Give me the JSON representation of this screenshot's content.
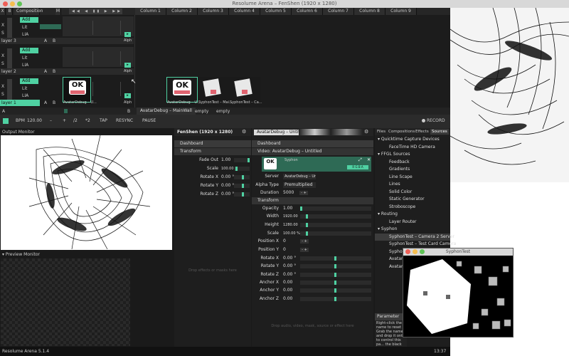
{
  "window": {
    "title": "Resolume Arena – FenShen (1920 x 1280)"
  },
  "grid": {
    "x_label": "X",
    "b_label": "B",
    "composition_label": "Composition",
    "m_label": "M",
    "columns": [
      "Column 1",
      "Column 2",
      "Column 3",
      "Column 4",
      "Column 5",
      "Column 6",
      "Column 7",
      "Column 8",
      "Column 9"
    ],
    "layers": [
      {
        "name": "layer 3",
        "add": "Add",
        "blend1": "Lit",
        "blend2": "LIA",
        "a": "A",
        "b": "B",
        "alpha": "Alph",
        "x": "X",
        "s": "S"
      },
      {
        "name": "layer 2",
        "add": "Add",
        "blend1": "Lit",
        "blend2": "LIA",
        "a": "A",
        "b": "B",
        "alpha": "Alph",
        "x": "X",
        "s": "S"
      },
      {
        "name": "layer 1",
        "add": "Add",
        "blend1": "Lit",
        "blend2": "LIA",
        "a": "A",
        "b": "B",
        "alpha": "Alph",
        "x": "X",
        "s": "S"
      }
    ],
    "clips": [
      "AvatarDebug – U...",
      "SyphonTest – Mai...",
      "SyphonTest – Ca..."
    ],
    "deck_a": "A",
    "deck_b": "B",
    "deck_name": "AvatarDebug – MainWall",
    "deck_tabs": [
      "empty",
      "empty"
    ]
  },
  "transport": {
    "bpm_label": "BPM",
    "bpm_value": "120.00",
    "minus": "–",
    "plus": "+",
    "div": "/2",
    "mul": "*2",
    "tap": "TAP",
    "resync": "RESYNC",
    "pause": "PAUSE",
    "record": "RECORD"
  },
  "output_monitor": {
    "title": "Output Monitor"
  },
  "preview_monitor": {
    "title": "Preview Monitor"
  },
  "comp_panel": {
    "title": "FenShen (1920 x 1280)",
    "dashboard": "Dashboard",
    "transform": "Transform",
    "rows": [
      {
        "label": "Fade Out",
        "value": "1.00"
      },
      {
        "label": "Scale",
        "value": "100.00 %"
      },
      {
        "label": "Rotate X",
        "value": "0.00 °"
      },
      {
        "label": "Rotate Y",
        "value": "0.00 °"
      },
      {
        "label": "Rotate Z",
        "value": "0.00 °"
      }
    ],
    "drop_hint": "Drop effects or masks here"
  },
  "clip_panel": {
    "title": "AvatarDebug – Untitled",
    "dashboard": "Dashboard",
    "video_header": "Video: AvatarDebug – Untitled",
    "syphon_label": "Syphon",
    "server_label": "Server",
    "server_value": "AvatarDebug – Un...",
    "alpha_label": "Alpha Type",
    "alpha_value": "Premultiplied",
    "duration_label": "Duration",
    "duration_value": "5000",
    "transform": "Transform",
    "rows": [
      {
        "label": "Opacity",
        "value": "1.00"
      },
      {
        "label": "Width",
        "value": "1920.00"
      },
      {
        "label": "Height",
        "value": "1280.00"
      },
      {
        "label": "Scale",
        "value": "100.00 %"
      },
      {
        "label": "Position X",
        "value": "0"
      },
      {
        "label": "Position Y",
        "value": "0"
      },
      {
        "label": "Rotate X",
        "value": "0.00 °"
      },
      {
        "label": "Rotate Y",
        "value": "0.00 °"
      },
      {
        "label": "Rotate Z",
        "value": "0.00 °"
      },
      {
        "label": "Anchor X",
        "value": "0.00"
      },
      {
        "label": "Anchor Y",
        "value": "0.00"
      },
      {
        "label": "Anchor Z",
        "value": "0.00"
      }
    ],
    "drop_hint": "Drop audio, video, mask, source or effect here"
  },
  "browser": {
    "tabs": [
      "Files",
      "Compositions",
      "Effects",
      "Sources"
    ],
    "tree": [
      {
        "text": "Quicktime Capture Devices",
        "level": 0
      },
      {
        "text": "FaceTime HD Camera",
        "level": 1
      },
      {
        "text": "FFGL Sources",
        "level": 0
      },
      {
        "text": "Feedback",
        "level": 1
      },
      {
        "text": "Gradients",
        "level": 1
      },
      {
        "text": "Line Scape",
        "level": 1
      },
      {
        "text": "Lines",
        "level": 1
      },
      {
        "text": "Solid Color",
        "level": 1
      },
      {
        "text": "Static Generator",
        "level": 1
      },
      {
        "text": "Stroboscope",
        "level": 1
      },
      {
        "text": "Routing",
        "level": 0
      },
      {
        "text": "Layer Router",
        "level": 1
      },
      {
        "text": "Syphon",
        "level": 0
      },
      {
        "text": "SyphonTest – Camera 2 Server",
        "level": 1,
        "selected": true
      },
      {
        "text": "SyphonTest – Test Card Camera",
        "level": 1
      },
      {
        "text": "SyphonTest – Main Camera",
        "level": 1
      },
      {
        "text": "AvatarDebug – Untitled",
        "level": 1
      },
      {
        "text": "AvatarDe...",
        "level": 1
      }
    ]
  },
  "parameter": {
    "title": "Parameter",
    "text": "Right-click the name to reset it. Grab the name and drop it onto to control this pa... the black arrow to select one of the many parameter animation controls."
  },
  "syphon_window": {
    "title": "SyphonTest"
  },
  "statusbar": {
    "version": "Resolume Arena 5.1.4",
    "time": "13:37"
  },
  "colors": {
    "accent": "#4fd1a2",
    "dark_accent": "#2e6a55",
    "background": "#1a1a1a"
  }
}
